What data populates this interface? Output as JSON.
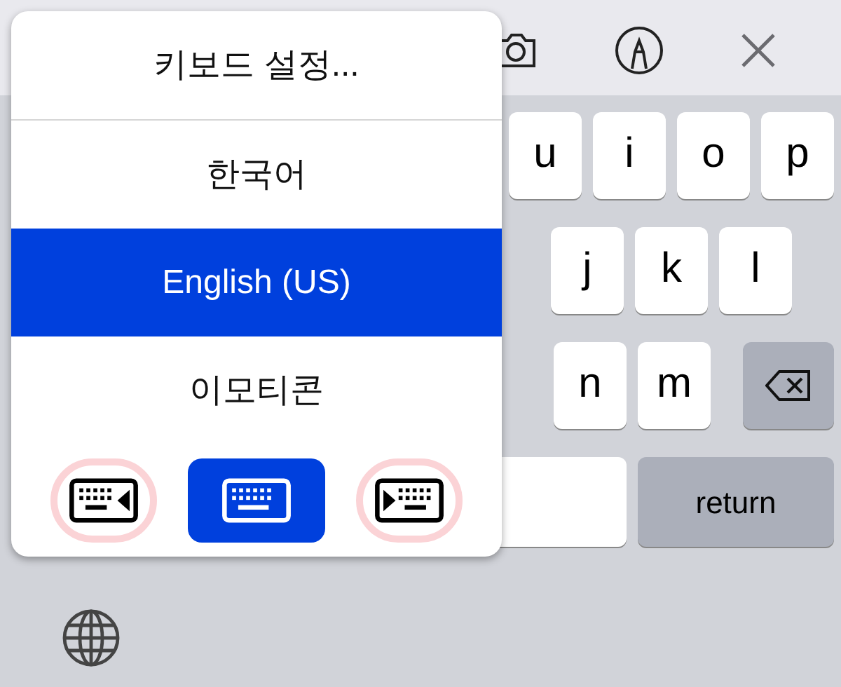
{
  "toolbar": {
    "buttons": [
      {
        "kind": "camera"
      },
      {
        "kind": "markup"
      },
      {
        "kind": "close"
      }
    ]
  },
  "keyboard": {
    "rows": [
      {
        "keys": [
          {
            "kind": "letter",
            "label": "u"
          },
          {
            "kind": "letter",
            "label": "i"
          },
          {
            "kind": "letter",
            "label": "o"
          },
          {
            "kind": "letter",
            "label": "p"
          }
        ]
      },
      {
        "keys": [
          {
            "kind": "letter",
            "label": "j"
          },
          {
            "kind": "letter",
            "label": "k"
          },
          {
            "kind": "letter",
            "label": "l"
          }
        ]
      },
      {
        "keys": [
          {
            "kind": "letter",
            "label": "n"
          },
          {
            "kind": "letter",
            "label": "m"
          },
          {
            "kind": "backspace"
          }
        ]
      },
      {
        "keys": [
          {
            "kind": "space"
          },
          {
            "kind": "return",
            "label": "return"
          }
        ]
      }
    ]
  },
  "popup": {
    "title": "키보드 설정...",
    "items": [
      {
        "label": "한국어",
        "selected": false
      },
      {
        "label": "English (US)",
        "selected": true
      },
      {
        "label": "이모티콘",
        "selected": false
      }
    ],
    "layout_buttons": [
      {
        "kind": "left",
        "selected": false,
        "highlighted": true
      },
      {
        "kind": "full",
        "selected": true,
        "highlighted": false
      },
      {
        "kind": "right",
        "selected": false,
        "highlighted": true
      }
    ]
  }
}
